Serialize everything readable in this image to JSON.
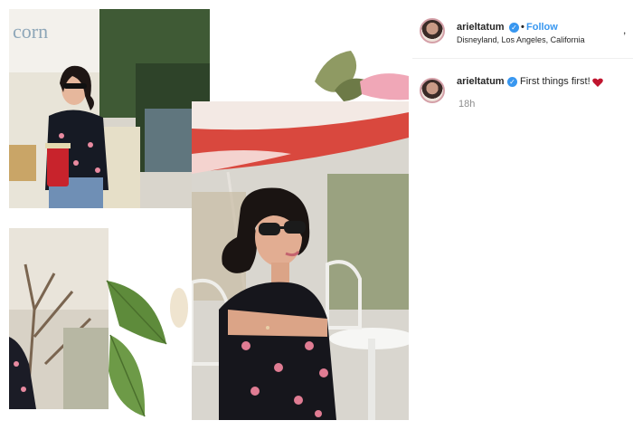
{
  "post": {
    "username": "arieltatum",
    "follow_label": "Follow",
    "separator": "•",
    "location": "Disneyland, Los Angeles, California",
    "more_label": ","
  },
  "comment": {
    "username": "arieltatum",
    "caption": "First things first!",
    "timestamp": "18h"
  },
  "collage": {
    "sign_text": "corn"
  },
  "colors": {
    "accent": "#3897f0",
    "verified": "#3897f0",
    "heart": "#c0152f"
  }
}
